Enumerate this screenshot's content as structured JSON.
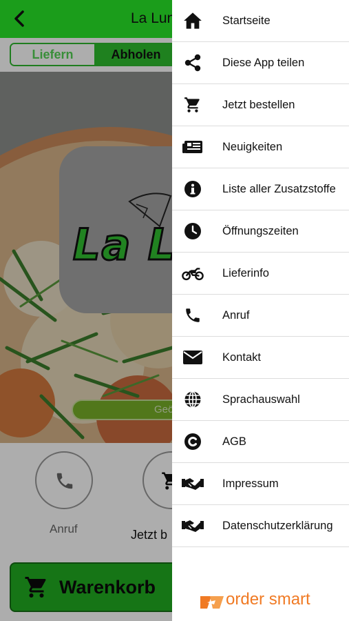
{
  "header": {
    "title": "La Lun"
  },
  "mode_toggle": {
    "deliver_label": "Liefern",
    "pickup_label": "Abholen"
  },
  "hero": {
    "logo_text": "La L",
    "hours_text": "Geö"
  },
  "actions": {
    "call_label": "Anruf",
    "order_label": "Jetzt b"
  },
  "cart": {
    "label": "Warenkorb"
  },
  "drawer": {
    "items": [
      {
        "label": "Startseite",
        "icon": "home-icon"
      },
      {
        "label": "Diese App teilen",
        "icon": "share-icon"
      },
      {
        "label": "Jetzt bestellen",
        "icon": "cart-icon"
      },
      {
        "label": "Neuigkeiten",
        "icon": "news-icon"
      },
      {
        "label": "Liste aller Zusatzstoffe",
        "icon": "info-icon"
      },
      {
        "label": "Öffnungszeiten",
        "icon": "clock-icon"
      },
      {
        "label": "Lieferinfo",
        "icon": "motorcycle-icon"
      },
      {
        "label": "Anruf",
        "icon": "phone-icon"
      },
      {
        "label": "Kontakt",
        "icon": "envelope-icon"
      },
      {
        "label": "Sprachauswahl",
        "icon": "globe-icon"
      },
      {
        "label": "AGB",
        "icon": "copyright-icon"
      },
      {
        "label": "Impressum",
        "icon": "handshake-icon"
      },
      {
        "label": "Datenschutzerklärung",
        "icon": "handshake-icon"
      }
    ],
    "brand": "order smart"
  },
  "colors": {
    "header_green": "#28e828",
    "cart_green": "#21ad21",
    "brand_orange": "#f07a24"
  }
}
